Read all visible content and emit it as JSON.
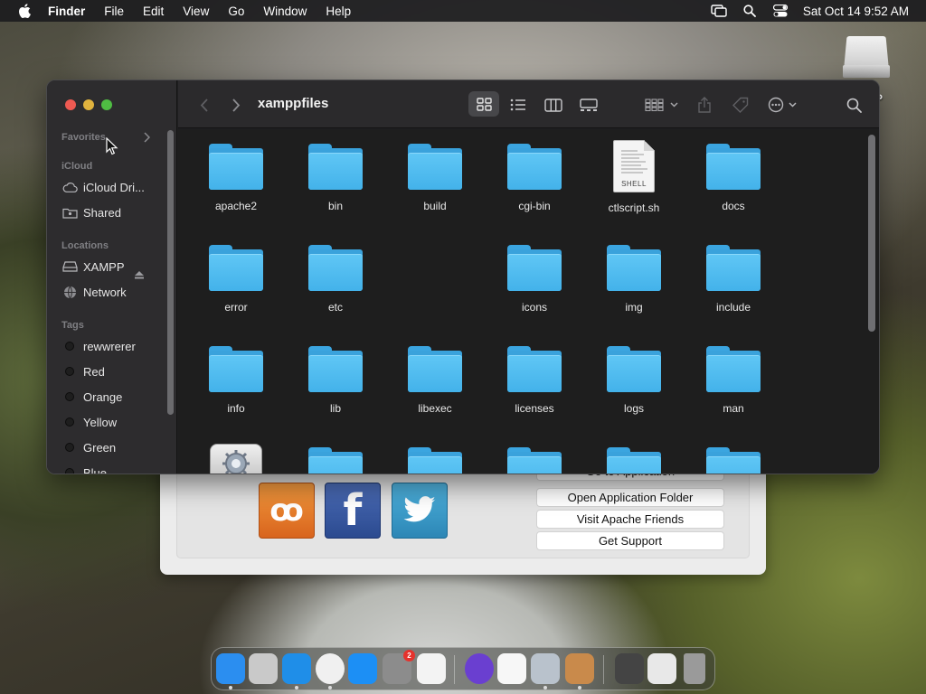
{
  "menubar": {
    "apple_icon": "apple-logo",
    "app_name": "Finder",
    "menus": [
      "File",
      "Edit",
      "View",
      "Go",
      "Window",
      "Help"
    ],
    "status_icons": [
      "screen-mirroring-icon",
      "spotlight-search-icon",
      "control-center-icon"
    ],
    "clock": "Sat Oct 14  9:52 AM"
  },
  "desktop": {
    "drive_label": "P"
  },
  "xampp": {
    "buttons": [
      "Go to Application",
      "Open Application Folder",
      "Visit Apache Friends",
      "Get Support"
    ],
    "logos": [
      "xampp-logo",
      "facebook-logo",
      "twitter-logo"
    ]
  },
  "finder": {
    "title": "xamppfiles",
    "sidebar": {
      "favorites_label": "Favorites",
      "icloud_label": "iCloud",
      "icloud_items": [
        {
          "label": "iCloud Dri...",
          "icon": "cloud-icon"
        },
        {
          "label": "Shared",
          "icon": "shared-folder-icon"
        }
      ],
      "locations_label": "Locations",
      "location_items": [
        {
          "label": "XAMPP",
          "icon": "disk-icon"
        },
        {
          "label": "Network",
          "icon": "globe-icon"
        }
      ],
      "tags_label": "Tags",
      "tags": [
        "rewwrerer",
        "Red",
        "Orange",
        "Yellow",
        "Green",
        "Blue"
      ]
    },
    "items": [
      {
        "name": "apache2",
        "kind": "folder"
      },
      {
        "name": "bin",
        "kind": "folder"
      },
      {
        "name": "build",
        "kind": "folder"
      },
      {
        "name": "cgi-bin",
        "kind": "folder"
      },
      {
        "name": "ctlscript.sh",
        "kind": "shell-script"
      },
      {
        "name": "docs",
        "kind": "folder"
      },
      {
        "name": "error",
        "kind": "folder"
      },
      {
        "name": "etc",
        "kind": "folder"
      },
      {
        "name": "",
        "kind": "empty"
      },
      {
        "name": "icons",
        "kind": "folder"
      },
      {
        "name": "img",
        "kind": "folder"
      },
      {
        "name": "include",
        "kind": "folder"
      },
      {
        "name": "info",
        "kind": "folder"
      },
      {
        "name": "lib",
        "kind": "folder"
      },
      {
        "name": "libexec",
        "kind": "folder"
      },
      {
        "name": "licenses",
        "kind": "folder"
      },
      {
        "name": "logs",
        "kind": "folder"
      },
      {
        "name": "man",
        "kind": "folder"
      },
      {
        "name": "",
        "kind": "app"
      },
      {
        "name": "",
        "kind": "folder"
      },
      {
        "name": "",
        "kind": "folder"
      },
      {
        "name": "",
        "kind": "folder"
      },
      {
        "name": "",
        "kind": "folder"
      },
      {
        "name": "",
        "kind": "folder"
      }
    ],
    "shell_badge": "SHELL"
  },
  "dock": {
    "apps": [
      {
        "name": "finder-icon",
        "running": true,
        "color": "#2b8ef0"
      },
      {
        "name": "launchpad-icon",
        "running": false,
        "color": "#c9c9c9"
      },
      {
        "name": "safari-icon",
        "running": true,
        "color": "#1f8ee8"
      },
      {
        "name": "chrome-icon",
        "running": true,
        "color": "#f0f0f0"
      },
      {
        "name": "app-store-icon",
        "running": false,
        "color": "#1c8ff5"
      },
      {
        "name": "system-settings-icon",
        "running": false,
        "color": "#8c8c8c",
        "badge": "2"
      },
      {
        "name": "textedit-icon",
        "running": false,
        "color": "#f3f3f3"
      },
      {
        "name": "firefox-icon",
        "running": false,
        "color": "#6a3fd0"
      },
      {
        "name": "news-icon",
        "running": false,
        "color": "#f7f7f7"
      },
      {
        "name": "xampp-manager-icon",
        "running": true,
        "color": "#b9c2cc"
      },
      {
        "name": "xampp-installer-icon",
        "running": true,
        "color": "#c98a4b"
      },
      {
        "name": "screenshot-thumbnail-1",
        "running": false,
        "color": "#444444"
      },
      {
        "name": "screenshot-thumbnail-2",
        "running": false,
        "color": "#e8e8e8"
      },
      {
        "name": "trash-icon",
        "running": false,
        "color": "#9a9a9a"
      }
    ]
  }
}
